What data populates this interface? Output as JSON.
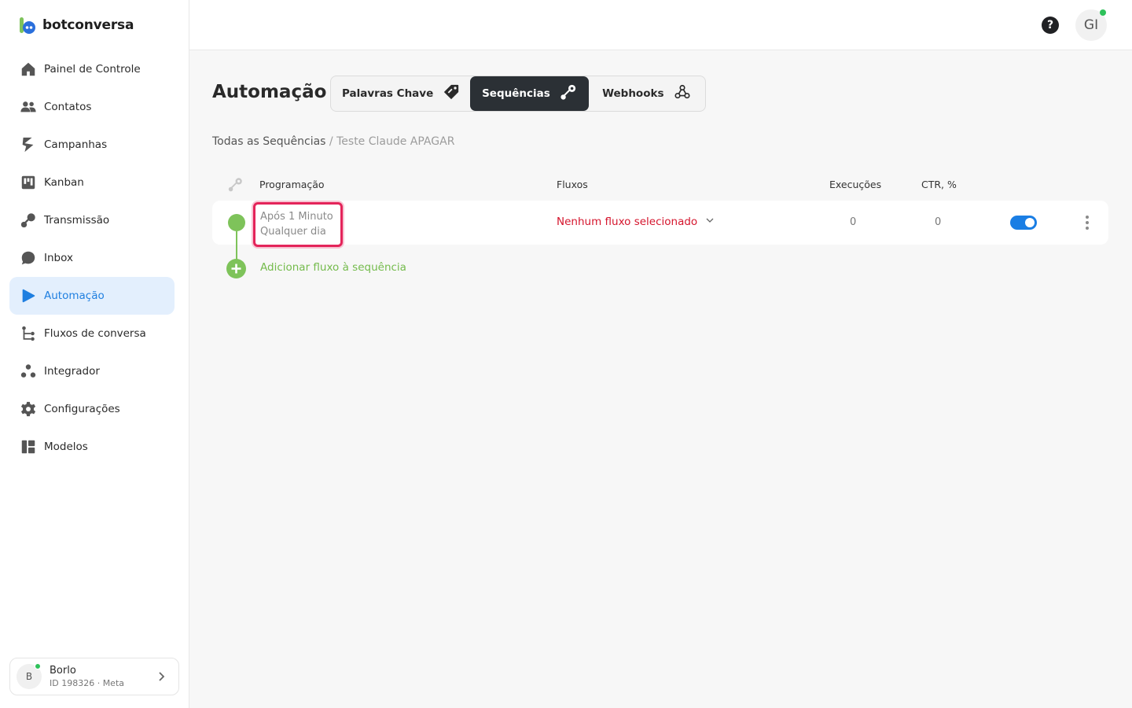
{
  "brand": {
    "name": "botconversa"
  },
  "sidebar": {
    "items": [
      {
        "label": "Painel de Controle",
        "icon": "home-icon"
      },
      {
        "label": "Contatos",
        "icon": "users-icon"
      },
      {
        "label": "Campanhas",
        "icon": "campaign-icon"
      },
      {
        "label": "Kanban",
        "icon": "kanban-icon"
      },
      {
        "label": "Transmissão",
        "icon": "broadcast-icon"
      },
      {
        "label": "Inbox",
        "icon": "chat-bubble-icon"
      },
      {
        "label": "Automação",
        "icon": "automation-icon",
        "active": true
      },
      {
        "label": "Fluxos de conversa",
        "icon": "flow-tree-icon"
      },
      {
        "label": "Integrador",
        "icon": "integrator-icon"
      },
      {
        "label": "Configurações",
        "icon": "gear-icon"
      },
      {
        "label": "Modelos",
        "icon": "templates-icon"
      }
    ],
    "account": {
      "initial": "B",
      "name": "Borlo",
      "sub": "ID 198326 · Meta"
    }
  },
  "topbar": {
    "help": "?",
    "user_initials": "GI"
  },
  "main": {
    "title": "Automação",
    "tabs": [
      {
        "label": "Palavras Chave",
        "icon": "tag-icon"
      },
      {
        "label": "Sequências",
        "icon": "sequence-icon",
        "active": true
      },
      {
        "label": "Webhooks",
        "icon": "webhook-icon"
      }
    ],
    "breadcrumb": {
      "parent": "Todas as Sequências",
      "separator": " / ",
      "current": "Teste Claude APAGAR"
    },
    "table": {
      "headers": {
        "programacao": "Programação",
        "fluxos": "Fluxos",
        "execucoes": "Execuções",
        "ctr": "CTR, %"
      },
      "rows": [
        {
          "schedule_line1": "Após 1 Minuto",
          "schedule_line2": "Qualquer dia",
          "flow": "Nenhum fluxo selecionado",
          "executions": "0",
          "ctr": "0",
          "enabled": true
        }
      ],
      "add_label": "Adicionar fluxo à sequência"
    }
  },
  "colors": {
    "accent": "#1f7fe0",
    "green": "#7ec35a",
    "error": "#d5152d",
    "highlight": "#e4245a",
    "tab_active": "#2b3035"
  }
}
